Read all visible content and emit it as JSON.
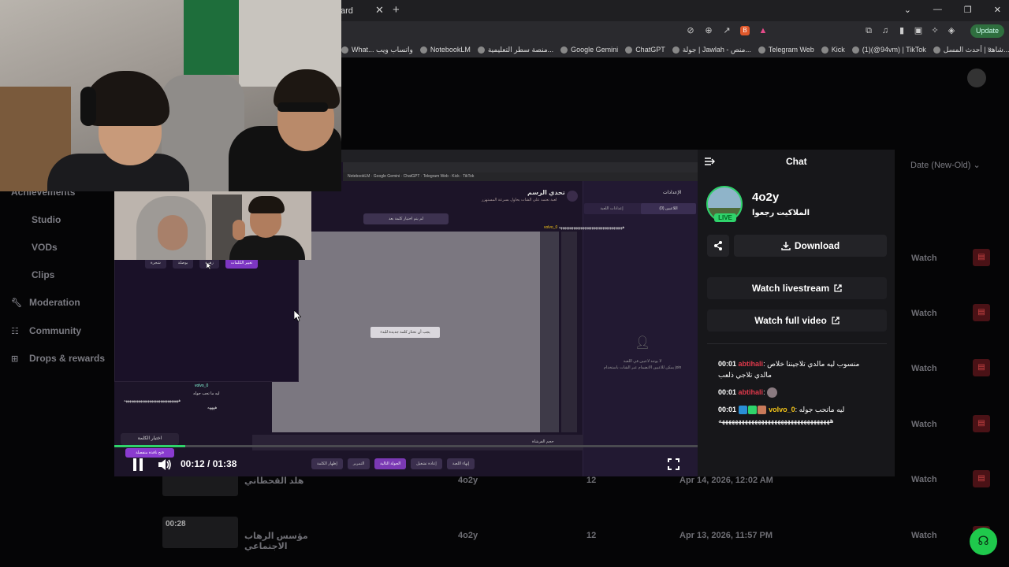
{
  "browser": {
    "tab_title": "ard",
    "update_label": "Update",
    "bookmarks": [
      "What... واتساب ويب",
      "NotebookLM",
      "منصة سطر التعليمية...",
      "Google Gemini",
      "ChatGPT",
      "جولة | Jawlah - منص...",
      "Telegram Web",
      "Kick",
      "(1)‏(@94vm) | TikTok",
      "شاهد | أحدث المسل..."
    ]
  },
  "sidebar": {
    "items": [
      {
        "label": "Achievements"
      },
      {
        "label": "Studio"
      },
      {
        "label": "VODs"
      },
      {
        "label": "Clips"
      },
      {
        "label": "Moderation"
      },
      {
        "label": "Community"
      },
      {
        "label": "Drops & rewards"
      }
    ]
  },
  "vods": {
    "sort_label": "Date (New-Old)",
    "watch_label": "Watch",
    "rows": [
      {
        "duration": "",
        "title": "هلد القحطاني",
        "channel": "4o2y",
        "count": "12",
        "date": "Apr 14, 2026, 12:02 AM"
      },
      {
        "duration": "00:28",
        "title": "مؤسس الرهاب الاجتماعي",
        "channel": "4o2y",
        "count": "12",
        "date": "Apr 13, 2026, 11:57 PM"
      }
    ]
  },
  "screen": {
    "game_title": "تحدي الرسم",
    "game_subtitle": "لعبة تعتمد على الشات يحاول بسرعة المستهزر",
    "settings_title": "الإعدادات",
    "tab_players": "اللاعبين (0)",
    "tab_game_settings": "إعدادات اللعبة",
    "status_msg": "لم يتم اختيار كلمة بعد",
    "canvas_msg": "يجب أن تختار كلمة جديدة للبدء",
    "no_players": "لا يوجد لاعبين في اللعبة",
    "no_players_hint": "يمكن للاعبين الانضمام عبر الشات باستخدام join",
    "stripe_user": "volvo_0",
    "stripe_text": "هههههههههههههههههههههههههههههههههههه",
    "size_label": "حجم الفرشاة",
    "buttons": [
      "إظهار الكلمة",
      "التمرير",
      "الجولة التالية",
      "إعادة تشغيل",
      "إنهاء اللعبة"
    ],
    "choose_word": "اختيار الكلمة",
    "open_window": "فتح نافذة منفصلة",
    "chat_user": "volvo_0",
    "chat_msg1": "ليه ما تحب جوله",
    "chat_msg2": "ههههههههههههههههههههههههههههههه",
    "chat_msg3": "ههههه"
  },
  "popup": {
    "words": [
      "شجرة",
      "بوصلة",
      "زهرة",
      "تغيير الكلمات"
    ]
  },
  "player": {
    "time": "00:12 / 01:38",
    "progress": 0.122
  },
  "chat": {
    "title": "Chat",
    "channel_name": "4o2y",
    "stream_title": "الملاكيت رجعوا",
    "live_label": "LIVE",
    "download_label": "Download",
    "watch_livestream_label": "Watch livestream",
    "watch_full_video_label": "Watch full video",
    "messages": [
      {
        "time": "00:01",
        "user": "abtihali",
        "text": "منسوب ليه مالدي تلاجيننا خلاص مالدي تلاجي ذلعب"
      },
      {
        "time": "00:01",
        "user": "abtihali",
        "text": ""
      },
      {
        "time": "00:01",
        "user": "volvo_0",
        "text": "ليه ماتحب جوله ههههههههههههههههههههههههههههههههههه"
      }
    ]
  },
  "colors": {
    "accent_green": "#2fd36b",
    "user_red": "#e0394b",
    "user_yellow": "#f5c518",
    "delete_red": "#4a1216"
  }
}
